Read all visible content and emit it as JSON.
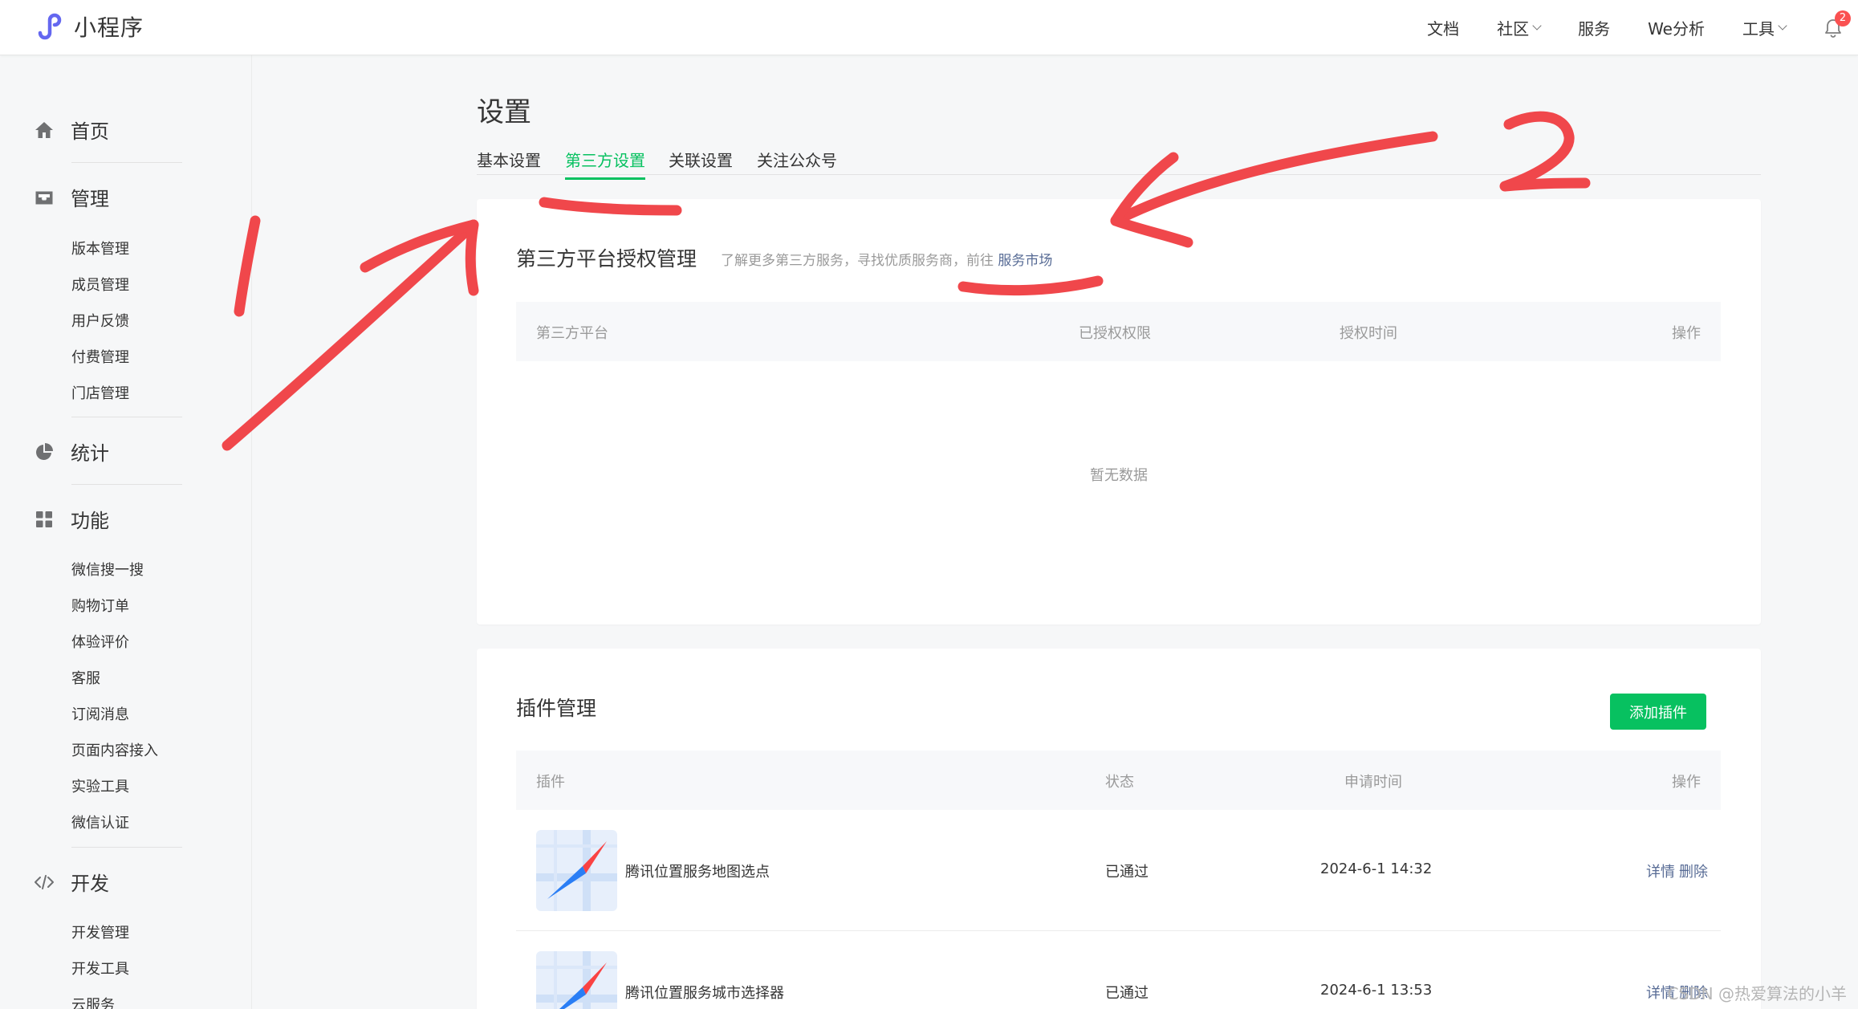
{
  "app": {
    "title": "小程序"
  },
  "topnav": {
    "docs": "文档",
    "community": "社区",
    "service": "服务",
    "we_analytics": "We分析",
    "tools": "工具",
    "notification_count": "2"
  },
  "sidebar": {
    "groups": [
      {
        "label": "首页",
        "icon": "home-icon"
      },
      {
        "label": "管理",
        "icon": "inbox-icon",
        "items": [
          "版本管理",
          "成员管理",
          "用户反馈",
          "付费管理",
          "门店管理"
        ]
      },
      {
        "label": "统计",
        "icon": "pie-chart-icon"
      },
      {
        "label": "功能",
        "icon": "grid-icon",
        "items": [
          "微信搜一搜",
          "购物订单",
          "体验评价",
          "客服",
          "订阅消息",
          "页面内容接入",
          "实验工具",
          "微信认证"
        ]
      },
      {
        "label": "开发",
        "icon": "code-icon",
        "items": [
          "开发管理",
          "开发工具",
          "云服务"
        ]
      }
    ]
  },
  "main": {
    "title": "设置",
    "tabs": [
      {
        "label": "基本设置",
        "active": false
      },
      {
        "label": "第三方设置",
        "active": true
      },
      {
        "label": "关联设置",
        "active": false
      },
      {
        "label": "关注公众号",
        "active": false
      }
    ],
    "third_party": {
      "title": "第三方平台授权管理",
      "tip": "了解更多第三方服务，寻找优质服务商，前往",
      "tip_link": "服务市场",
      "columns": [
        "第三方平台",
        "已授权权限",
        "授权时间",
        "操作"
      ],
      "empty_text": "暂无数据"
    },
    "plugins": {
      "title": "插件管理",
      "add_button": "添加插件",
      "columns": [
        "插件",
        "状态",
        "申请时间",
        "操作"
      ],
      "rows": [
        {
          "name": "腾讯位置服务地图选点",
          "status": "已通过",
          "time": "2024-6-1 14:32",
          "detail": "详情",
          "delete": "删除"
        },
        {
          "name": "腾讯位置服务城市选择器",
          "status": "已通过",
          "time": "2024-6-1 13:53",
          "detail": "详情",
          "delete": "删除"
        }
      ]
    }
  },
  "annotations": {
    "label_1": "1",
    "label_2": "2"
  },
  "watermark": "CSDN @热爱算法的小羊",
  "colors": {
    "accent": "#07c160",
    "link": "#576b95",
    "annotation": "#f0474b",
    "badge": "#fa5151"
  }
}
